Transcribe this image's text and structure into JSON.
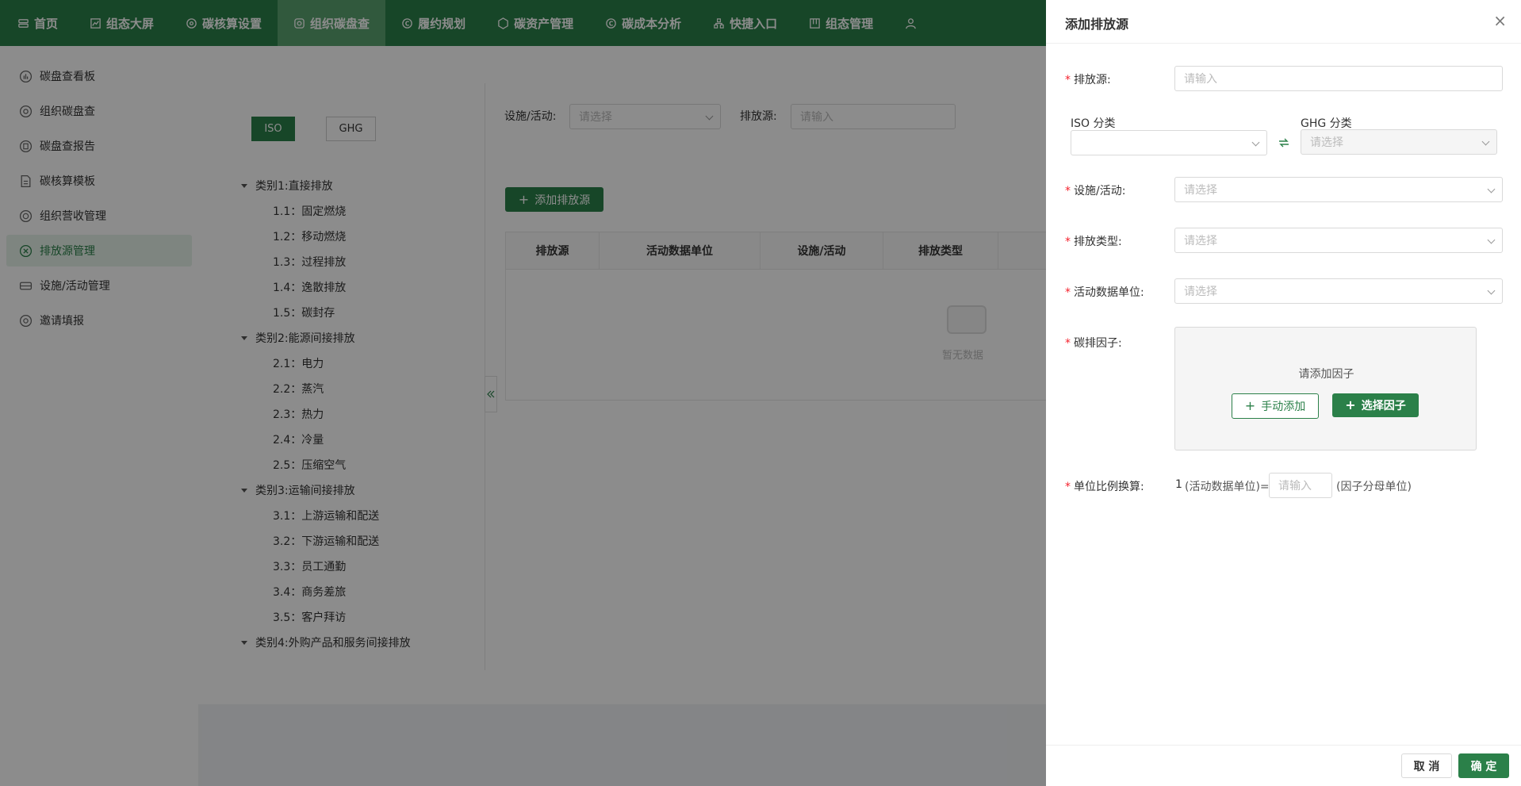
{
  "topnav": {
    "items": [
      {
        "label": "首页",
        "icon": "home-icon"
      },
      {
        "label": "组态大屏",
        "icon": "chart-icon"
      },
      {
        "label": "碳核算设置",
        "icon": "settings-icon"
      },
      {
        "label": "组织碳盘查",
        "icon": "search-icon",
        "active": true
      },
      {
        "label": "履约规划",
        "icon": "plan-icon"
      },
      {
        "label": "碳资产管理",
        "icon": "asset-icon"
      },
      {
        "label": "碳成本分析",
        "icon": "cost-icon"
      },
      {
        "label": "快捷入口",
        "icon": "shortcut-icon"
      },
      {
        "label": "组态管理",
        "icon": "layout-icon"
      }
    ]
  },
  "sidebar": {
    "items": [
      {
        "label": "碳盘查看板",
        "icon": "dashboard-icon"
      },
      {
        "label": "组织碳盘查",
        "icon": "search-icon"
      },
      {
        "label": "碳盘查报告",
        "icon": "report-icon"
      },
      {
        "label": "碳核算模板",
        "icon": "template-icon"
      },
      {
        "label": "组织营收管理",
        "icon": "revenue-icon"
      },
      {
        "label": "排放源管理",
        "icon": "emission-icon",
        "active": true
      },
      {
        "label": "设施/活动管理",
        "icon": "facility-icon"
      },
      {
        "label": "邀请填报",
        "icon": "invite-icon"
      }
    ]
  },
  "main": {
    "tabs": [
      "ISO",
      "GHG"
    ],
    "filter": {
      "facility_label": "设施/活动:",
      "facility_placeholder": "请选择",
      "source_label": "排放源:",
      "source_placeholder": "请输入"
    },
    "add_button": "添加排放源",
    "table_headers": [
      "排放源",
      "活动数据单位",
      "设施/活动",
      "排放类型"
    ],
    "empty_text": "暂无数据",
    "tree": [
      {
        "label": "类别1:直接排放",
        "type": "cat"
      },
      {
        "label": "1.1：固定燃烧",
        "type": "leaf"
      },
      {
        "label": "1.2：移动燃烧",
        "type": "leaf"
      },
      {
        "label": "1.3：过程排放",
        "type": "leaf"
      },
      {
        "label": "1.4：逸散排放",
        "type": "leaf"
      },
      {
        "label": "1.5：碳封存",
        "type": "leaf"
      },
      {
        "label": "类别2:能源间接排放",
        "type": "cat"
      },
      {
        "label": "2.1：电力",
        "type": "leaf"
      },
      {
        "label": "2.2：蒸汽",
        "type": "leaf"
      },
      {
        "label": "2.3：热力",
        "type": "leaf"
      },
      {
        "label": "2.4：冷量",
        "type": "leaf"
      },
      {
        "label": "2.5：压缩空气",
        "type": "leaf"
      },
      {
        "label": "类别3:运输间接排放",
        "type": "cat"
      },
      {
        "label": "3.1：上游运输和配送",
        "type": "leaf"
      },
      {
        "label": "3.2：下游运输和配送",
        "type": "leaf"
      },
      {
        "label": "3.3：员工通勤",
        "type": "leaf"
      },
      {
        "label": "3.4：商务差旅",
        "type": "leaf"
      },
      {
        "label": "3.5：客户拜访",
        "type": "leaf"
      },
      {
        "label": "类别4:外购产品和服务间接排放",
        "type": "cat"
      }
    ]
  },
  "drawer": {
    "title": "添加排放源",
    "close": "×",
    "source_label": "排放源:",
    "source_placeholder": "请输入",
    "iso_label": "ISO 分类",
    "ghg_label": "GHG 分类",
    "ghg_placeholder": "请选择",
    "facility_label": "设施/活动:",
    "facility_placeholder": "请选择",
    "emission_type_label": "排放类型:",
    "emission_type_placeholder": "请选择",
    "unit_label": "活动数据单位:",
    "unit_placeholder": "请选择",
    "factor_label": "碳排因子:",
    "factor_hint": "请添加因子",
    "manual_add": "手动添加",
    "select_factor": "选择因子",
    "ratio_label": "单位比例换算:",
    "ratio_one": "1",
    "ratio_left": "(活动数据单位)=",
    "ratio_placeholder": "请输入",
    "ratio_right": "(因子分母单位)",
    "required_mark": "*",
    "cancel": "取 消",
    "ok": "确 定"
  },
  "colors": {
    "accent": "#2b8049",
    "required": "#f5222d"
  }
}
